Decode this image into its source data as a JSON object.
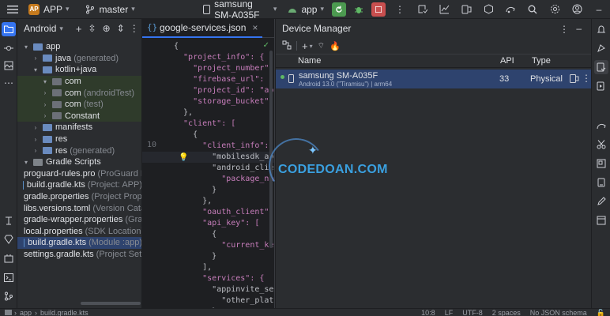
{
  "topbar": {
    "project_badge": "AP",
    "project_name": "APP",
    "branch": "master",
    "device": "samsung SM-A035F",
    "run_config": "app"
  },
  "project_panel": {
    "view_mode": "Android",
    "tree": [
      {
        "label": "app",
        "dim": "",
        "depth": 0,
        "arrow": "v",
        "icon": "folder-blue"
      },
      {
        "label": "java",
        "dim": "(generated)",
        "depth": 1,
        "arrow": ">",
        "icon": "folder-blue"
      },
      {
        "label": "kotlin+java",
        "dim": "",
        "depth": 1,
        "arrow": "v",
        "icon": "folder-blue"
      },
      {
        "label": "com",
        "dim": "",
        "depth": 2,
        "arrow": "v",
        "icon": "package"
      },
      {
        "label": "com",
        "dim": "(androidTest)",
        "depth": 2,
        "arrow": ">",
        "icon": "package"
      },
      {
        "label": "com",
        "dim": "(test)",
        "depth": 2,
        "arrow": ">",
        "icon": "package"
      },
      {
        "label": "Constant",
        "dim": "",
        "depth": 2,
        "arrow": ">",
        "icon": "package"
      },
      {
        "label": "manifests",
        "dim": "",
        "depth": 1,
        "arrow": ">",
        "icon": "folder-blue"
      },
      {
        "label": "res",
        "dim": "",
        "depth": 1,
        "arrow": ">",
        "icon": "folder-blue"
      },
      {
        "label": "res",
        "dim": "(generated)",
        "depth": 1,
        "arrow": ">",
        "icon": "folder-blue"
      },
      {
        "label": "Gradle Scripts",
        "dim": "",
        "depth": 0,
        "arrow": "v",
        "icon": "gradle"
      },
      {
        "label": "proguard-rules.pro",
        "dim": "(ProGuard R",
        "depth": 1,
        "arrow": "",
        "icon": "file"
      },
      {
        "label": "build.gradle.kts",
        "dim": "(Project: APP)",
        "depth": 1,
        "arrow": "",
        "icon": "file"
      },
      {
        "label": "gradle.properties",
        "dim": "(Project Prope",
        "depth": 1,
        "arrow": "",
        "icon": "file"
      },
      {
        "label": "libs.versions.toml",
        "dim": "(Version Cata",
        "depth": 1,
        "arrow": "",
        "icon": "file"
      },
      {
        "label": "gradle-wrapper.properties",
        "dim": "(Gra",
        "depth": 1,
        "arrow": "",
        "icon": "file"
      },
      {
        "label": "local.properties",
        "dim": "(SDK Location)",
        "depth": 1,
        "arrow": "",
        "icon": "file"
      },
      {
        "label": "build.gradle.kts",
        "dim": "(Module :app)",
        "depth": 1,
        "arrow": "",
        "icon": "file"
      },
      {
        "label": "settings.gradle.kts",
        "dim": "(Project Sett",
        "depth": 1,
        "arrow": "",
        "icon": "file"
      }
    ]
  },
  "editor": {
    "tab_label": "google-services.json",
    "lines": [
      {
        "n": "",
        "t": "{"
      },
      {
        "n": "",
        "t": "  \"project_info\": {"
      },
      {
        "n": "",
        "t": "    \"project_number\": \"264"
      },
      {
        "n": "",
        "t": "    \"firebase_url\": \"https"
      },
      {
        "n": "",
        "t": "    \"project_id\": \"appsach"
      },
      {
        "n": "",
        "t": "    \"storage_bucket\": \"app"
      },
      {
        "n": "",
        "t": "  },"
      },
      {
        "n": "",
        "t": "  \"client\": ["
      },
      {
        "n": "",
        "t": "    {"
      },
      {
        "n": "10",
        "t": "      \"client_info\": {"
      },
      {
        "n": "",
        "t": "        \"mobilesdk_app_id\""
      },
      {
        "n": "",
        "t": "        \"android_client_i"
      },
      {
        "n": "",
        "t": "          \"package_name\":"
      },
      {
        "n": "",
        "t": "        }"
      },
      {
        "n": "",
        "t": "      },"
      },
      {
        "n": "",
        "t": "      \"oauth_client\": [],"
      },
      {
        "n": "",
        "t": "      \"api_key\": ["
      },
      {
        "n": "",
        "t": "        {"
      },
      {
        "n": "",
        "t": "          \"current_key\": \""
      },
      {
        "n": "",
        "t": "        }"
      },
      {
        "n": "",
        "t": "      ],"
      },
      {
        "n": "",
        "t": "      \"services\": {"
      },
      {
        "n": "",
        "t": "        \"appinvite_service"
      },
      {
        "n": "",
        "t": "          \"other_platform_o"
      },
      {
        "n": "",
        "t": "        }"
      }
    ]
  },
  "device_manager": {
    "title": "Device Manager",
    "columns": {
      "name": "Name",
      "api": "API",
      "type": "Type"
    },
    "devices": [
      {
        "name": "samsung SM-A035F",
        "sub": "Android 13.0 (\"Tiramisu\") | arm64",
        "api": "33",
        "type": "Physical"
      }
    ]
  },
  "statusbar": {
    "crumbs": [
      "app",
      "build.gradle.kts"
    ],
    "position": "10:8",
    "line_sep": "LF",
    "encoding": "UTF-8",
    "indent": "2 spaces",
    "schema": "No JSON schema"
  },
  "watermark": "CODEDOAN.COM",
  "colors": {
    "accent": "#3574f0",
    "run": "#4c9a50",
    "stop": "#c94f4f",
    "selection": "#2e436e"
  }
}
